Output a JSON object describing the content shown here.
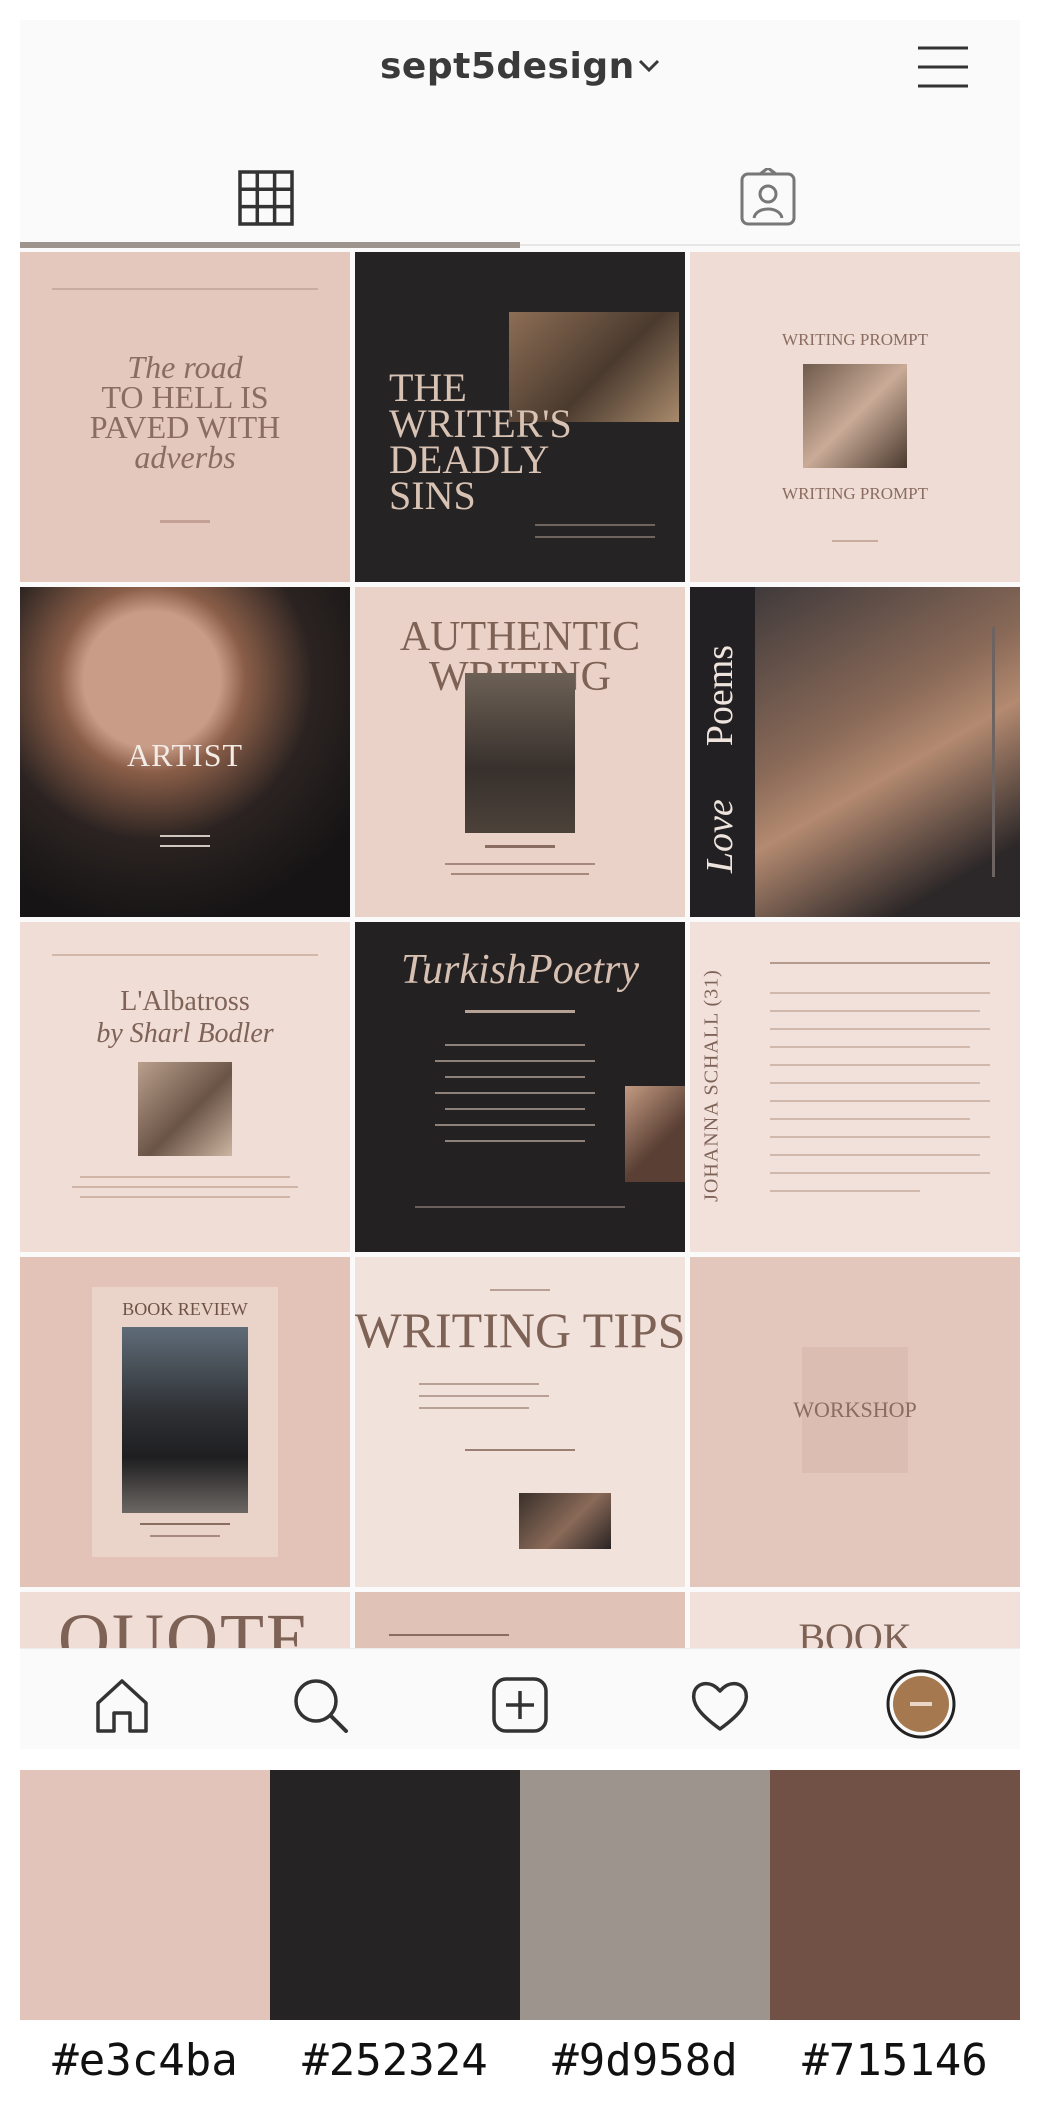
{
  "header": {
    "username": "sept5design"
  },
  "icons": {
    "chevron": "chevron-down-icon",
    "menu": "hamburger-menu-icon",
    "grid_tab": "grid-icon",
    "tagged_tab": "tagged-person-icon",
    "home": "home-icon",
    "search": "search-icon",
    "add": "add-post-icon",
    "activity": "heart-icon",
    "profile": "profile-avatar"
  },
  "posts": {
    "p1": {
      "line1": "The road",
      "line2": "TO HELL IS",
      "line3": "PAVED WITH",
      "line4": "adverbs"
    },
    "p2": {
      "line1": "THE",
      "line2": "WRITER'S",
      "line3": "DEADLY",
      "line4": "SINS"
    },
    "p3": {
      "top": "WRITING PROMPT",
      "bottom": "WRITING PROMPT"
    },
    "p4": {
      "title": "ARTIST"
    },
    "p5": {
      "line1": "AUTHENTIC",
      "line2": "WRITING"
    },
    "p6": {
      "word1": "Love",
      "word2": "Poems"
    },
    "p7": {
      "line1": "L'Albatross",
      "line2": "by Sharl Bodler"
    },
    "p8": {
      "title": "TurkishPoetry"
    },
    "p9": {
      "vertical": "JOHANNA SCHALL (31)"
    },
    "p10": {
      "title": "BOOK REVIEW"
    },
    "p11": {
      "title": "WRITING TIPS"
    },
    "p12": {
      "title": "WORKSHOP"
    },
    "p13": {
      "title": "QUOTE"
    },
    "p15": {
      "title": "BOOK"
    }
  },
  "palette": {
    "colors": [
      "#e3c4ba",
      "#252324",
      "#9d958d",
      "#715146"
    ],
    "labels": [
      "#e3c4ba",
      "#252324",
      "#9d958d",
      "#715146"
    ]
  }
}
